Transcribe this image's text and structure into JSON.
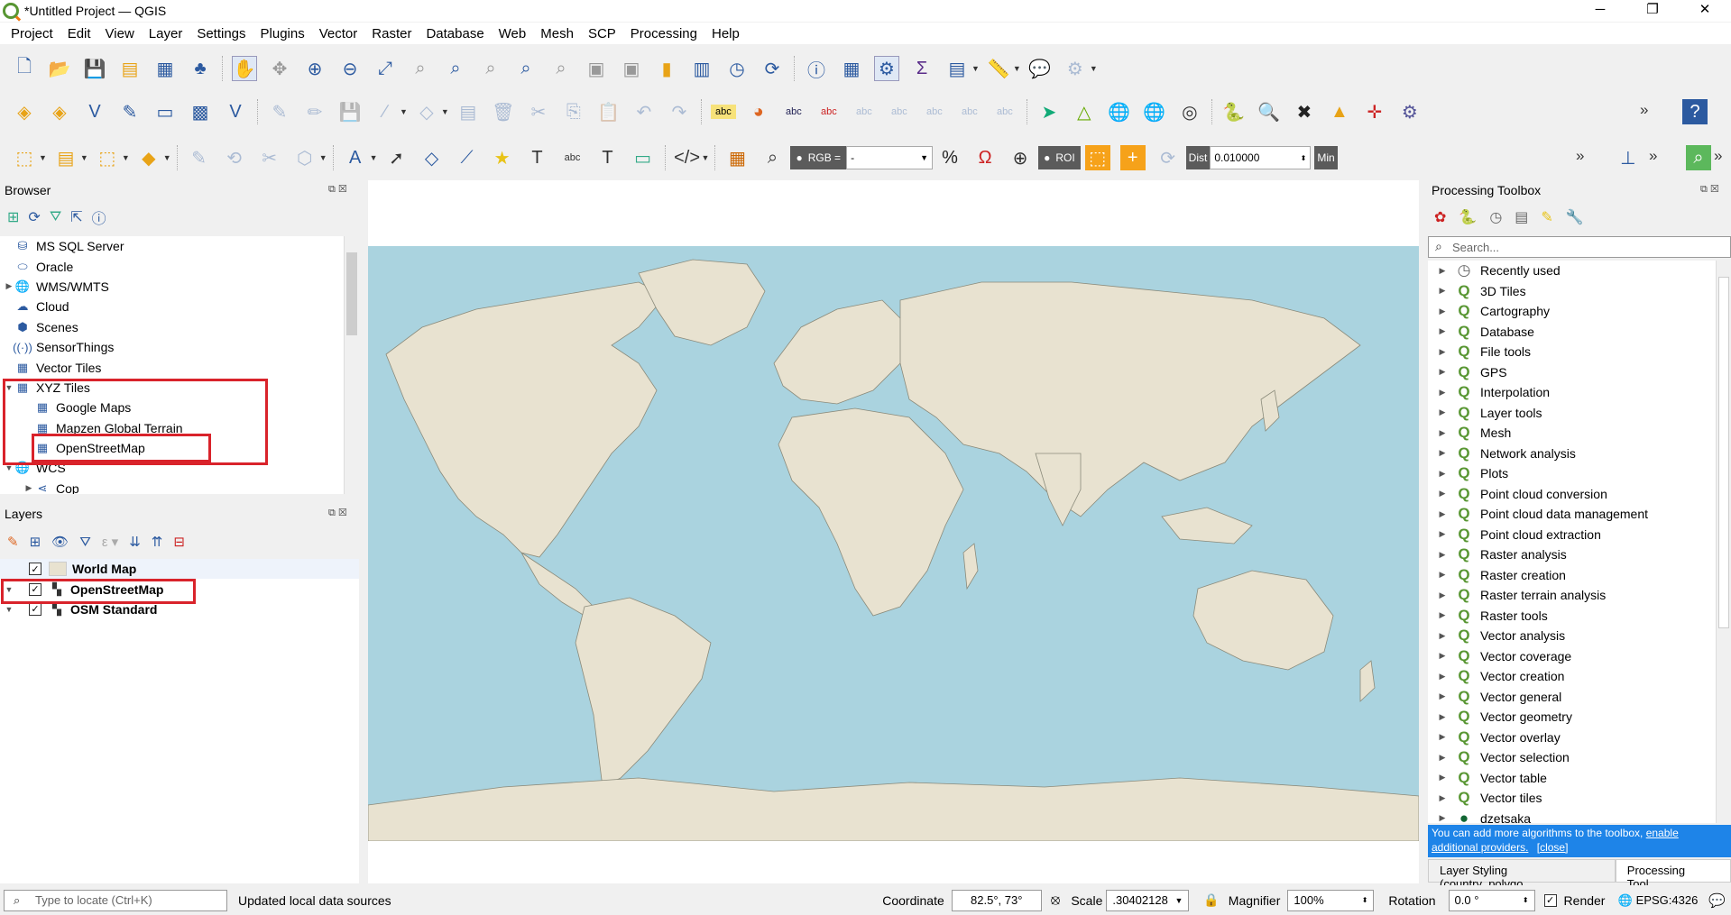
{
  "window": {
    "title": "*Untitled Project — QGIS",
    "minimize": "─",
    "restore": "❐",
    "close": "✕"
  },
  "menu": [
    "Project",
    "Edit",
    "View",
    "Layer",
    "Settings",
    "Plugins",
    "Vector",
    "Raster",
    "Database",
    "Web",
    "Mesh",
    "SCP",
    "Processing",
    "Help"
  ],
  "toolbar3": {
    "rgb_label": "RGB =",
    "rgb_value": "-",
    "roi_label": "ROI",
    "dist_label": "Dist",
    "dist_value": "0.010000",
    "min_label": "Min"
  },
  "browser": {
    "title": "Browser",
    "items": [
      {
        "label": "MS SQL Server",
        "icon": "mssql-icon",
        "exp": ""
      },
      {
        "label": "Oracle",
        "icon": "oracle-icon",
        "exp": ""
      },
      {
        "label": "WMS/WMTS",
        "icon": "globe-icon",
        "exp": "▶"
      },
      {
        "label": "Cloud",
        "icon": "cloud-icon",
        "exp": ""
      },
      {
        "label": "Scenes",
        "icon": "cube-icon",
        "exp": ""
      },
      {
        "label": "SensorThings",
        "icon": "sensor-icon",
        "exp": ""
      },
      {
        "label": "Vector Tiles",
        "icon": "grid-icon",
        "exp": ""
      },
      {
        "label": "XYZ Tiles",
        "icon": "grid-icon",
        "exp": "▼"
      },
      {
        "label": "Google Maps",
        "icon": "grid-icon",
        "exp": "",
        "child": true
      },
      {
        "label": "Mapzen Global Terrain",
        "icon": "grid-icon",
        "exp": "",
        "child": true
      },
      {
        "label": "OpenStreetMap",
        "icon": "grid-icon",
        "exp": "",
        "child": true
      },
      {
        "label": "WCS",
        "icon": "globe-icon",
        "exp": "▼"
      },
      {
        "label": "Cop",
        "icon": "wcs-icon",
        "exp": "▶",
        "child": true
      }
    ]
  },
  "layers": {
    "title": "Layers",
    "items": [
      {
        "label": "World Map",
        "exp": "",
        "checked": true
      },
      {
        "label": "OpenStreetMap",
        "exp": "▼",
        "checked": true
      },
      {
        "label": "OSM Standard",
        "exp": "▼",
        "checked": true
      }
    ]
  },
  "toolbox": {
    "title": "Processing Toolbox",
    "search_placeholder": "Search...",
    "items": [
      "Recently used",
      "3D Tiles",
      "Cartography",
      "Database",
      "File tools",
      "GPS",
      "Interpolation",
      "Layer tools",
      "Mesh",
      "Network analysis",
      "Plots",
      "Point cloud conversion",
      "Point cloud data management",
      "Point cloud extraction",
      "Raster analysis",
      "Raster creation",
      "Raster terrain analysis",
      "Raster tools",
      "Vector analysis",
      "Vector coverage",
      "Vector creation",
      "Vector general",
      "Vector geometry",
      "Vector overlay",
      "Vector selection",
      "Vector table",
      "Vector tiles",
      "dzetsaka"
    ],
    "info_text": "You can add more algorithms to the toolbox, ",
    "info_link": "enable additional providers.",
    "info_close": "[close]",
    "tabs": [
      "Layer Styling (country_polygo...",
      "Processing Tool..."
    ]
  },
  "status": {
    "locate_placeholder": "Type to locate (Ctrl+K)",
    "message": "Updated local data sources",
    "coordinate_label": "Coordinate",
    "coordinate_value": "82.5°, 73°",
    "scale_label": "Scale",
    "scale_value": ".30402128",
    "magnifier_label": "Magnifier",
    "magnifier_value": "100%",
    "rotation_label": "Rotation",
    "rotation_value": "0.0 °",
    "render_label": "Render",
    "crs": "EPSG:4326"
  },
  "colors": {
    "water": "#aad3df",
    "land": "#e8e2d0",
    "highlight": "#d9232b",
    "accent": "#589632"
  }
}
